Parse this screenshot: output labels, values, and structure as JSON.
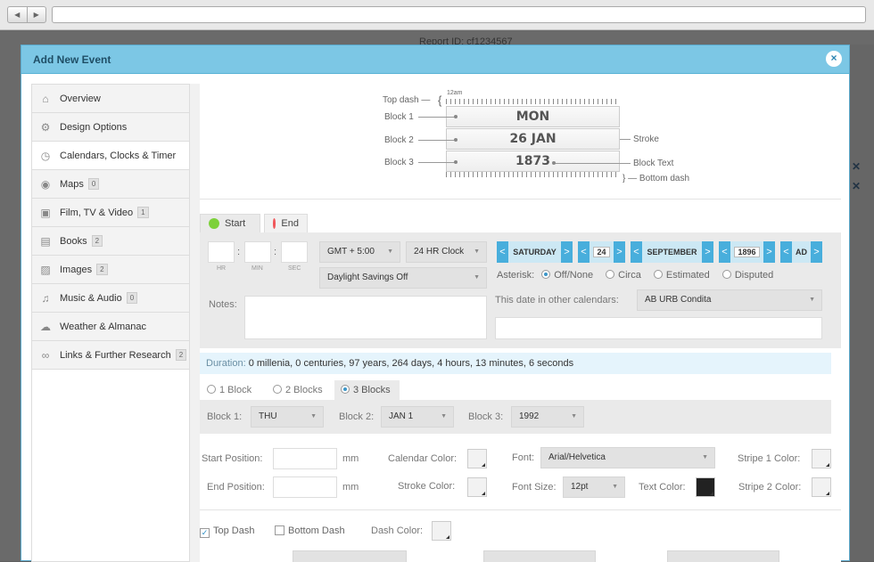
{
  "browser": {
    "back_glyph": "◀",
    "forward_glyph": "▶"
  },
  "background": {
    "report_id": "Report ID:  cf1234567"
  },
  "modal": {
    "title": "Add New Event",
    "close_glyph": "×"
  },
  "sidebar": {
    "items": [
      {
        "label": "Overview",
        "icon": "home-icon",
        "glyph": "⌂",
        "badge": ""
      },
      {
        "label": "Design Options",
        "icon": "gear-icon",
        "glyph": "⚙",
        "badge": ""
      },
      {
        "label": "Calendars, Clocks & Timer",
        "icon": "alarm-clock-icon",
        "glyph": "◷",
        "badge": ""
      },
      {
        "label": "Maps",
        "icon": "globe-icon",
        "glyph": "◉",
        "badge": "0"
      },
      {
        "label": "Film, TV & Video",
        "icon": "film-icon",
        "glyph": "▣",
        "badge": "1"
      },
      {
        "label": "Books",
        "icon": "book-icon",
        "glyph": "▤",
        "badge": "2"
      },
      {
        "label": "Images",
        "icon": "image-icon",
        "glyph": "▨",
        "badge": "2"
      },
      {
        "label": "Music & Audio",
        "icon": "music-icon",
        "glyph": "♫",
        "badge": "0"
      },
      {
        "label": "Weather & Almanac",
        "icon": "weather-icon",
        "glyph": "☁",
        "badge": ""
      },
      {
        "label": "Links & Further Research",
        "icon": "link-icon",
        "glyph": "∞",
        "badge": "2"
      }
    ]
  },
  "diagram": {
    "top_dash": "Top dash —",
    "brace_top": "{",
    "tick_label": "12am",
    "block1": "Block 1",
    "block2": "Block 2",
    "block3": "Block 3",
    "stroke": "Stroke",
    "block_text": "Block Text",
    "bottom_dash": "} — Bottom dash",
    "day": "MON",
    "date": "26 JAN",
    "year": "1873"
  },
  "tabs": {
    "start": "Start",
    "end": "End",
    "start_color": "#7dd13a",
    "end_color": "#f0565a"
  },
  "time": {
    "hr": "HR",
    "min": "MIN",
    "sec": "SEC",
    "colon": ":"
  },
  "timezone": "GMT + 5:00",
  "clock": "24 HR Clock",
  "daylight": "Daylight Savings Off",
  "spinners": {
    "day": "SATURDAY",
    "date": "24",
    "month": "SEPTEMBER",
    "year": "1896",
    "era": "AD",
    "prev": "<",
    "next": ">"
  },
  "asterisk": {
    "label": "Asterisk:",
    "options": [
      "Off/None",
      "Circa",
      "Estimated",
      "Disputed"
    ]
  },
  "notes_label": "Notes:",
  "other_calendars": {
    "label": "This date in other calendars:",
    "value": "AB URB Condita"
  },
  "duration": {
    "label": "Duration:",
    "value": "0 millenia, 0 centuries, 97 years, 264 days, 4 hours, 13 minutes, 6 seconds"
  },
  "blocks": {
    "options": [
      "1 Block",
      "2 Blocks",
      "3 Blocks"
    ],
    "b1_label": "Block 1:",
    "b1": "THU",
    "b2_label": "Block 2:",
    "b2": "JAN 1",
    "b3_label": "Block 3:",
    "b3": "1992"
  },
  "design": {
    "start_position": "Start Position:",
    "end_position": "End Position:",
    "mm": "mm",
    "calendar_color": "Calendar Color:",
    "stroke_color": "Stroke Color:",
    "font_label": "Font:",
    "font": "Arial/Helvetica",
    "font_size_label": "Font Size:",
    "font_size": "12pt",
    "text_color": "Text Color:",
    "text_color_value": "#222222",
    "stripe1": "Stripe 1 Color:",
    "stripe2": "Stripe 2 Color:"
  },
  "dash": {
    "top": "Top Dash",
    "bottom": "Bottom Dash",
    "color": "Dash Color:",
    "check_glyph": "✓"
  }
}
